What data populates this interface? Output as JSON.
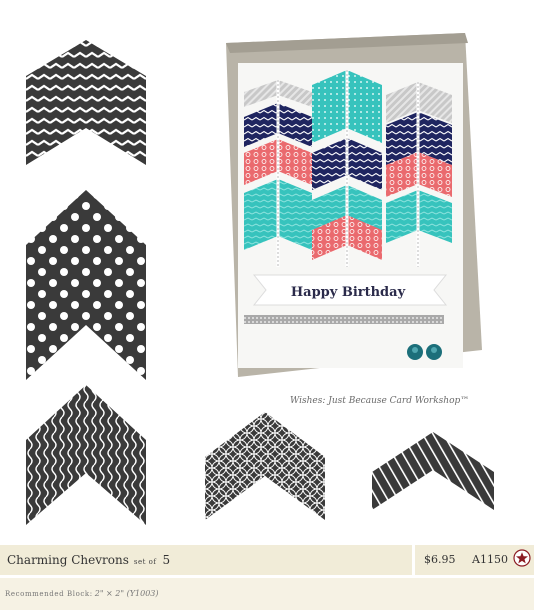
{
  "product": {
    "name": "Charming Chevrons",
    "set_of_label": "set of",
    "count": "5",
    "price": "$6.95",
    "item_code": "A1150",
    "recommended_label": "Recommended Block:",
    "recommended_value": "2\" × 2\" (Y1003)"
  },
  "card": {
    "greeting": "Happy Birthday",
    "caption": "Wishes: Just Because Card Workshop™"
  },
  "colors": {
    "stamp_ink": "#3a3a3a",
    "card_kraft": "#b9b4a8",
    "card_white": "#f7f7f5",
    "navy": "#1f2560",
    "coral": "#ea6a6e",
    "aqua": "#37c3bd",
    "silver": "#bdbdbd",
    "bar_primary": "#f1ecd8",
    "bar_secondary": "#f6f2e4",
    "star_badge": "#8c1c23"
  },
  "icons": [
    "star-badge-icon"
  ]
}
